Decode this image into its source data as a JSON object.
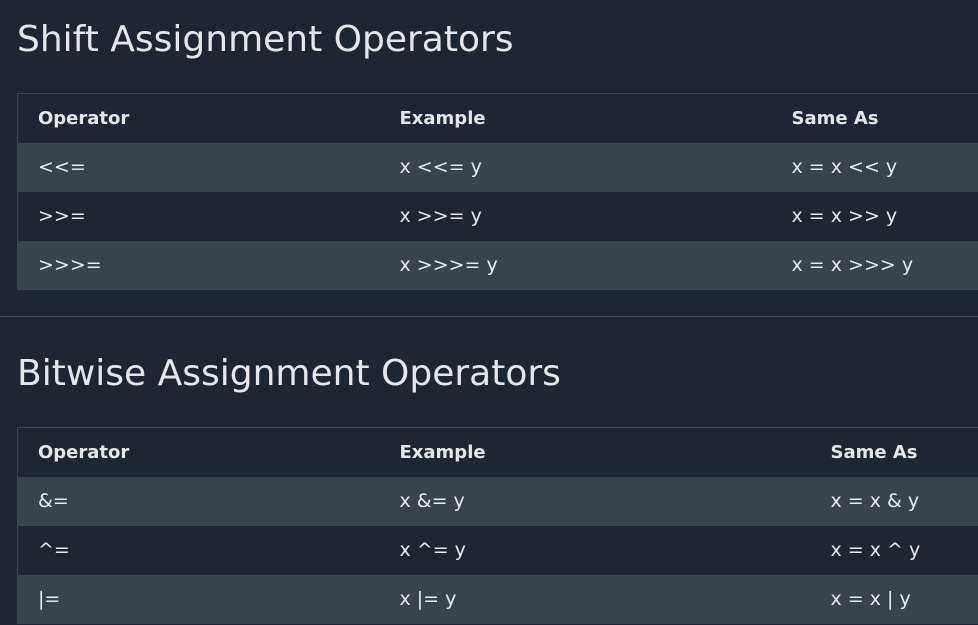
{
  "sections": [
    {
      "title": "Shift Assignment Operators",
      "headers": [
        "Operator",
        "Example",
        "Same As"
      ],
      "rows": [
        [
          "<<=",
          "x <<= y",
          "x = x << y"
        ],
        [
          ">>=",
          "x >>= y",
          "x = x >> y"
        ],
        [
          ">>>=",
          "x >>>= y",
          "x = x >>> y"
        ]
      ]
    },
    {
      "title": "Bitwise Assignment Operators",
      "headers": [
        "Operator",
        "Example",
        "Same As"
      ],
      "rows": [
        [
          "&=",
          "x &= y",
          "x = x & y"
        ],
        [
          "^=",
          "x ^= y",
          "x = x ^ y"
        ],
        [
          "|=",
          "x |= y",
          "x = x | y"
        ]
      ]
    }
  ],
  "colors": {
    "background": "#1d2733",
    "stripe": "#38444d",
    "border": "#3b4651",
    "text": "#e9ecef"
  }
}
